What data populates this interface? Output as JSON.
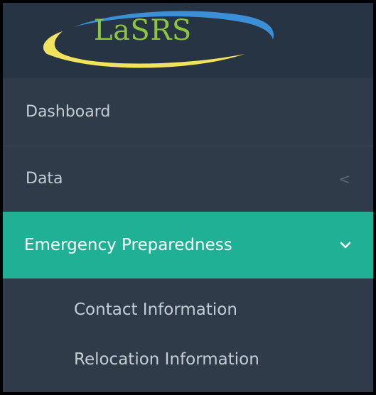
{
  "logo": {
    "text": "LaSRS",
    "colors": {
      "text": "#8cc63f",
      "swoosh_blue": "#3a8fd6",
      "swoosh_yellow": "#f2e35c"
    }
  },
  "sidebar": {
    "items": [
      {
        "label": "Dashboard"
      },
      {
        "label": "Data",
        "chevron": "<"
      },
      {
        "label": "Emergency Preparedness",
        "active": true,
        "children": [
          {
            "label": "Contact Information"
          },
          {
            "label": "Relocation Information"
          }
        ]
      }
    ]
  },
  "colors": {
    "sidebar_bg": "#2f3b49",
    "header_bg": "#263443",
    "active_bg": "#1fb096",
    "text": "#c5ccd4",
    "active_text": "#ffffff"
  }
}
